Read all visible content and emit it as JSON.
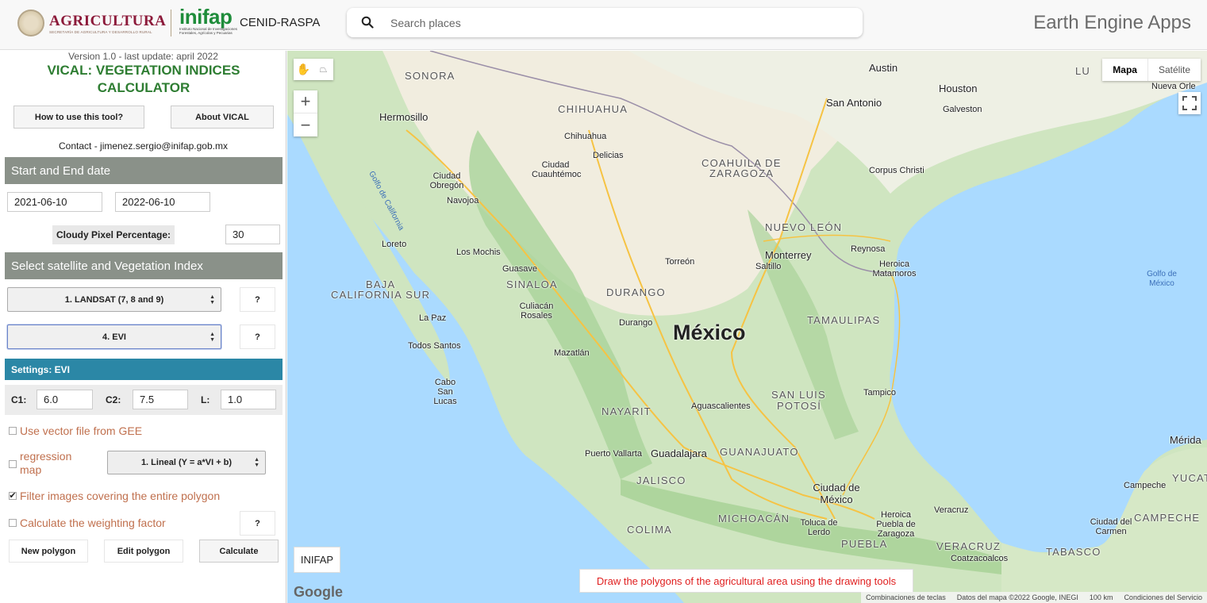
{
  "header": {
    "agri_title": "AGRICULTURA",
    "agri_subtitle": "SECRETARÍA DE AGRICULTURA Y DESARROLLO RURAL",
    "inifap_word": "inifap",
    "inifap_subtitle": "Instituto Nacional de Investigaciones Forestales, Agrícolas y Pecuarias",
    "center_name": "CENID-RASPA",
    "search_placeholder": "Search places",
    "brand": "Earth Engine Apps"
  },
  "panel": {
    "version": "Version 1.0 - last update: april 2022",
    "title": "VICAL: VEGETATION INDICES CALCULATOR",
    "how_to_button": "How to use this tool?",
    "about_button": "About VICAL",
    "contact": "Contact - jimenez.sergio@inifap.gob.mx",
    "dates_section": "Start and End date",
    "start_date": "2021-06-10",
    "end_date": "2022-06-10",
    "cloudy_label": "Cloudy Pixel Percentage:",
    "cloudy_value": "30",
    "satellite_section": "Select satellite and Vegetation Index",
    "satellite_select": "1. LANDSAT (7, 8 and 9)",
    "index_select": "4. EVI",
    "help_label": "?",
    "settings_title": "Settings: EVI",
    "c1_label": "C1:",
    "c1_value": "6.0",
    "c2_label": "C2:",
    "c2_value": "7.5",
    "l_label": "L:",
    "l_value": "1.0",
    "vector_label": "Use vector file from GEE",
    "regression_label": "regression map",
    "regression_select": "1. Lineal (Y = a*VI + b)",
    "filter_label": "Filter images covering the entire polygon",
    "weighting_label": "Calculate the weighting factor",
    "new_polygon": "New polygon",
    "edit_polygon": "Edit polygon",
    "calculate": "Calculate"
  },
  "map": {
    "maptype_map": "Mapa",
    "maptype_sat": "Satélite",
    "inifap_button": "INIFAP",
    "draw_message": "Draw the polygons of the agricultural area using the drawing tools",
    "google": "Google",
    "attrib_keys": "Combinaciones de teclas",
    "attrib_data": "Datos del mapa ©2022 Google, INEGI",
    "attrib_scale": "100 km",
    "attrib_terms": "Condiciones del Servicio",
    "country": "México",
    "states": [
      "SONORA",
      "CHIHUAHUA",
      "COAHUILA DE",
      "ZARAGOZA",
      "NUEVO LEÓN",
      "BAJA",
      "CALIFORNIA SUR",
      "SINALOA",
      "DURANGO",
      "TAMAULIPAS",
      "SAN LUIS",
      "POTOSÍ",
      "NAYARIT",
      "GUANAJUATO",
      "JALISCO",
      "MICHOACÁN",
      "COLIMA",
      "PUEBLA",
      "VERACRUZ",
      "TABASCO",
      "CAMPECHE",
      "YUCAT",
      "LU"
    ],
    "cities": [
      "Hermosillo",
      "Chihuahua",
      "Delicias",
      "Ciudad Cuauhtémoc",
      "Ciudad Obregón",
      "Navojoa",
      "Loreto",
      "Los Mochis",
      "Guasave",
      "Culiacán Rosales",
      "La Paz",
      "Todos Santos",
      "Cabo San Lucas",
      "Mazatlán",
      "Durango",
      "Torreón",
      "Saltillo",
      "Monterrey",
      "Reynosa",
      "Heroica Matamoros",
      "Austin",
      "Houston",
      "San Antonio",
      "Galveston",
      "Corpus Christi",
      "Nueva Orle",
      "Tampico",
      "Aguascalientes",
      "Puerto Vallarta",
      "Guadalajara",
      "Ciudad de México",
      "Veracruz",
      "Heroica Puebla de Zaragoza",
      "Toluca de Lerdo",
      "Coatzacoalcos",
      "Ciudad del Carmen",
      "Campeche",
      "Mérida"
    ],
    "water": [
      "Golfo de California",
      "Golfo de México"
    ]
  }
}
